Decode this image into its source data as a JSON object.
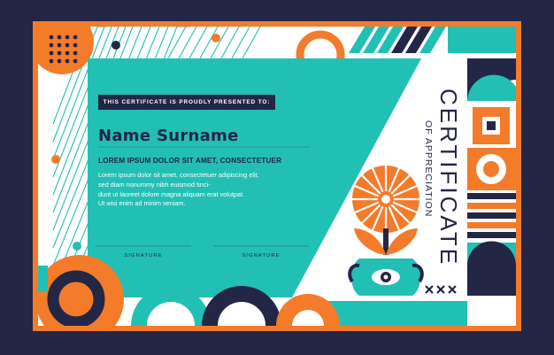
{
  "certificate": {
    "presented_to": "THIS CERTIFICATE IS PROUDLY PRESENTED TO:",
    "recipient_name": "Name Surname",
    "subtitle": "LOREM IPSUM DOLOR SIT AMET, CONSECTETUER",
    "body_lines": [
      "Lorem ipsum dolor sit amet, consectetuer adipiscing elit,",
      "sed diam nonummy nibh euismod tinci-",
      "dunt ut laoreet dolore magna aliquam erat volutpat.",
      "Ut wisi enim ad minim veniam."
    ],
    "signature_left": "SIGNATURE",
    "signature_right": "SIGNATURE",
    "title_main": "CERTIFICATE",
    "title_sub": "OF APPRECIATION"
  },
  "colors": {
    "background": "#232645",
    "orange": "#F47B2A",
    "teal": "#22BFB5",
    "navy": "#232645",
    "white": "#FFFFFF"
  }
}
